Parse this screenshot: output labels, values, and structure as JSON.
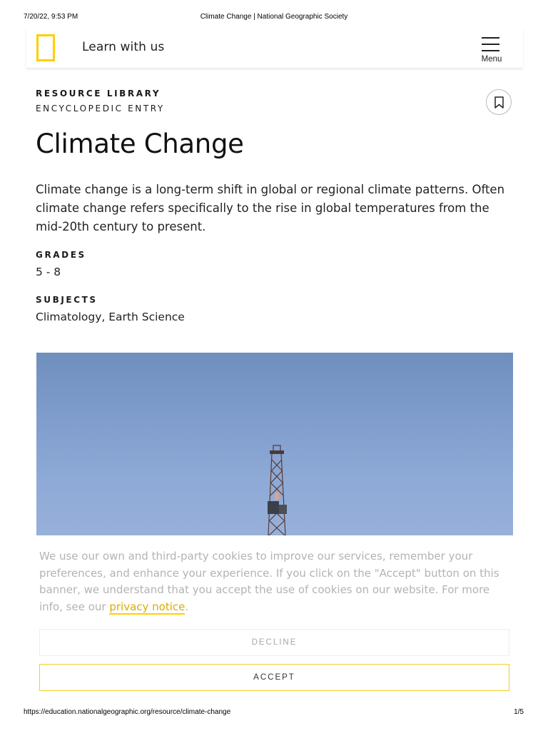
{
  "print_header": {
    "datetime": "7/20/22, 9:53 PM",
    "doc_title": "Climate Change | National Geographic Society"
  },
  "header": {
    "logo_icon": "natgeo-yellow-border-logo",
    "tagline": "Learn with us",
    "menu_icon": "hamburger-icon",
    "menu_label": "Menu"
  },
  "article": {
    "kicker": "RESOURCE LIBRARY",
    "type": "ENCYCLOPEDIC ENTRY",
    "bookmark_icon": "bookmark-icon",
    "title": "Climate Change",
    "intro": "Climate change is a long-term shift in global or regional climate patterns. Often climate change refers specifically to the rise in global temperatures from the mid-20th century to present.",
    "grades_label": "GRADES",
    "grades_value": "5 - 8",
    "subjects_label": "SUBJECTS",
    "subjects_value": "Climatology, Earth Science"
  },
  "cookie_banner": {
    "text": "We use our own and third-party cookies to improve our services, remember your preferences, and enhance your experience. If you click on the \"Accept\" button on this banner, we understand that you accept the use of cookies on our website. For more info, see our",
    "link_text": "privacy notice",
    "trailing": ".",
    "decline_label": "DECLINE",
    "accept_label": "ACCEPT"
  },
  "print_footer": {
    "url": "https://education.nationalgeographic.org/resource/climate-change",
    "page": "1/5"
  },
  "colors": {
    "brand_yellow": "#ffce00",
    "sky_blue": "#8eaad6"
  }
}
